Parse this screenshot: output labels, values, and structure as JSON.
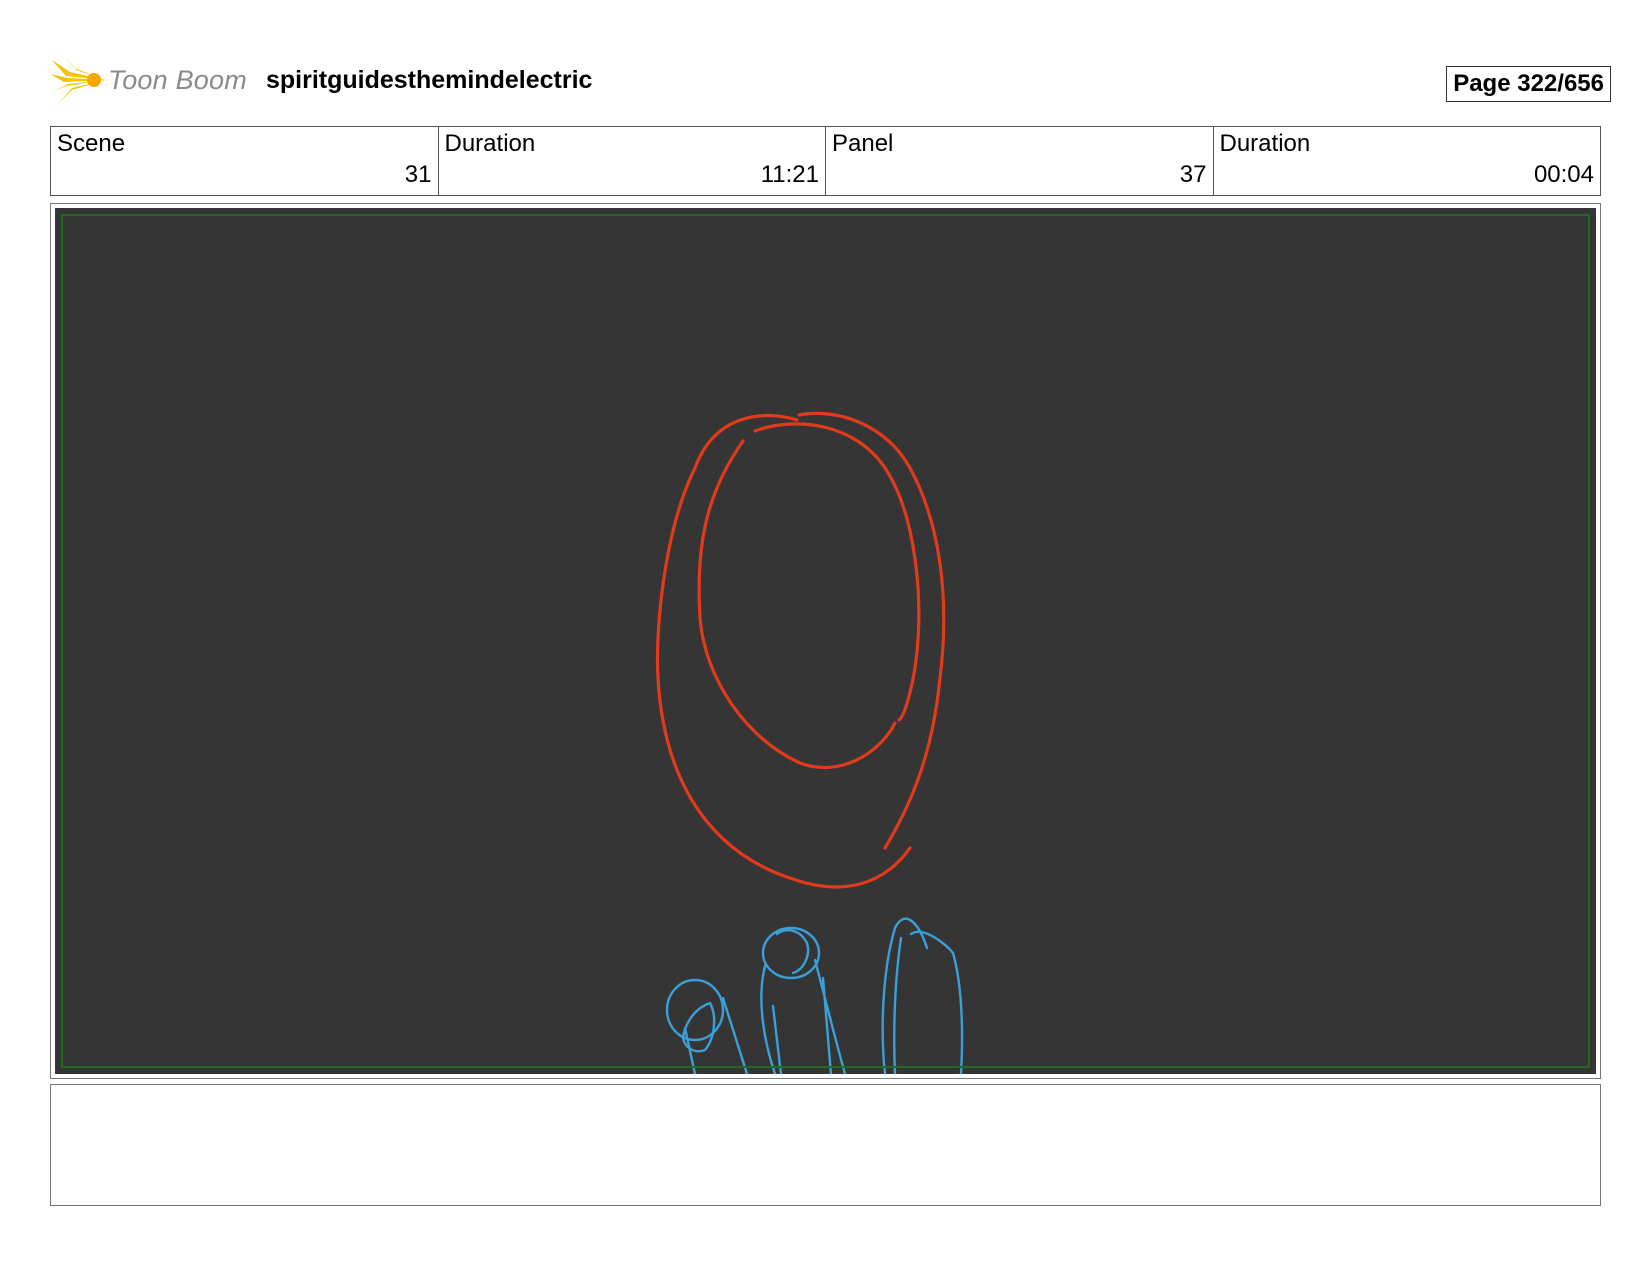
{
  "header": {
    "logo_text": "Toon Boom",
    "project_title": "spiritguidesthemindelectric",
    "page_label": "Page 322/656"
  },
  "info": {
    "scene_label": "Scene",
    "scene_value": "31",
    "scene_duration_label": "Duration",
    "scene_duration_value": "11:21",
    "panel_label": "Panel",
    "panel_value": "37",
    "panel_duration_label": "Duration",
    "panel_duration_value": "00:04"
  },
  "panel": {
    "background_color": "#353535",
    "safe_frame_color": "#1f6b1f",
    "sketch_colors": {
      "portal": "#e23b1b",
      "figures": "#3b9fd8"
    }
  },
  "notes": {
    "text": ""
  }
}
